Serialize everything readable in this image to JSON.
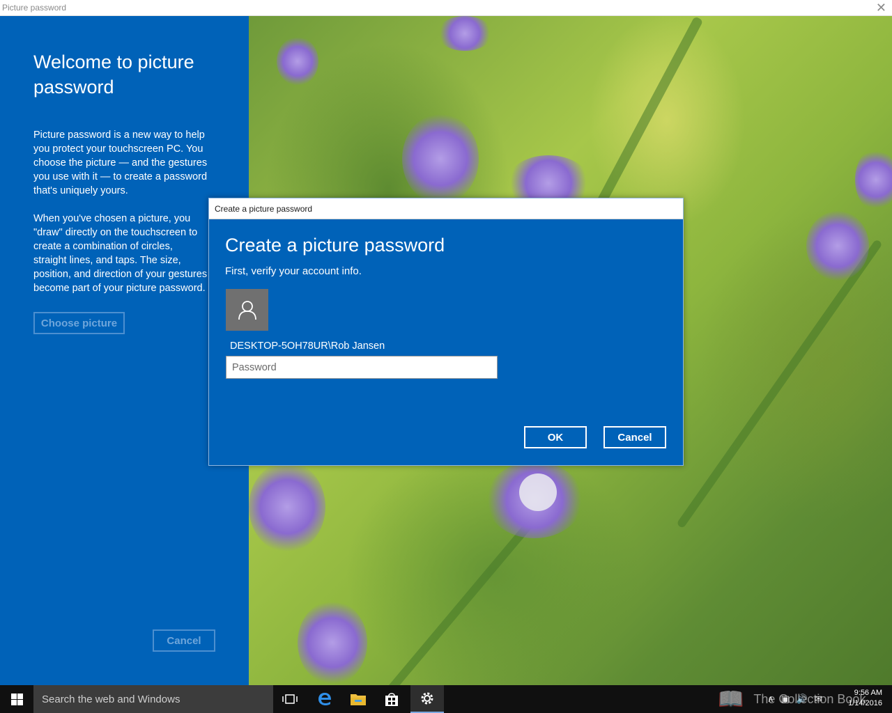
{
  "window": {
    "title": "Picture password",
    "close_glyph": "✕"
  },
  "left_panel": {
    "heading": "Welcome to picture password",
    "paragraph1": "Picture password is a new way to help you protect your touchscreen PC. You choose the picture — and the gestures you use with it — to create a password that's uniquely yours.",
    "paragraph2": "When you've chosen a picture, you \"draw\" directly on the touchscreen to create a combination of circles, straight lines, and taps. The size, position, and direction of your gestures become part of your picture password.",
    "choose_button": "Choose picture",
    "cancel_button": "Cancel"
  },
  "dialog": {
    "window_title": "Create a picture password",
    "heading": "Create a picture password",
    "subtitle": "First, verify your account info.",
    "account_name": "DESKTOP-5OH78UR\\Rob Jansen",
    "password_placeholder": "Password",
    "password_value": "",
    "ok_button": "OK",
    "cancel_button": "Cancel"
  },
  "taskbar": {
    "search_placeholder": "Search the web and Windows",
    "watermark": "The Collection Book",
    "time": "9:56 AM",
    "date": "1/14/2016",
    "icons": [
      "start-icon",
      "task-view-icon",
      "edge-icon",
      "file-explorer-icon",
      "store-icon",
      "settings-icon"
    ]
  },
  "colors": {
    "accent": "#0062b8",
    "taskbar": "#101010"
  }
}
